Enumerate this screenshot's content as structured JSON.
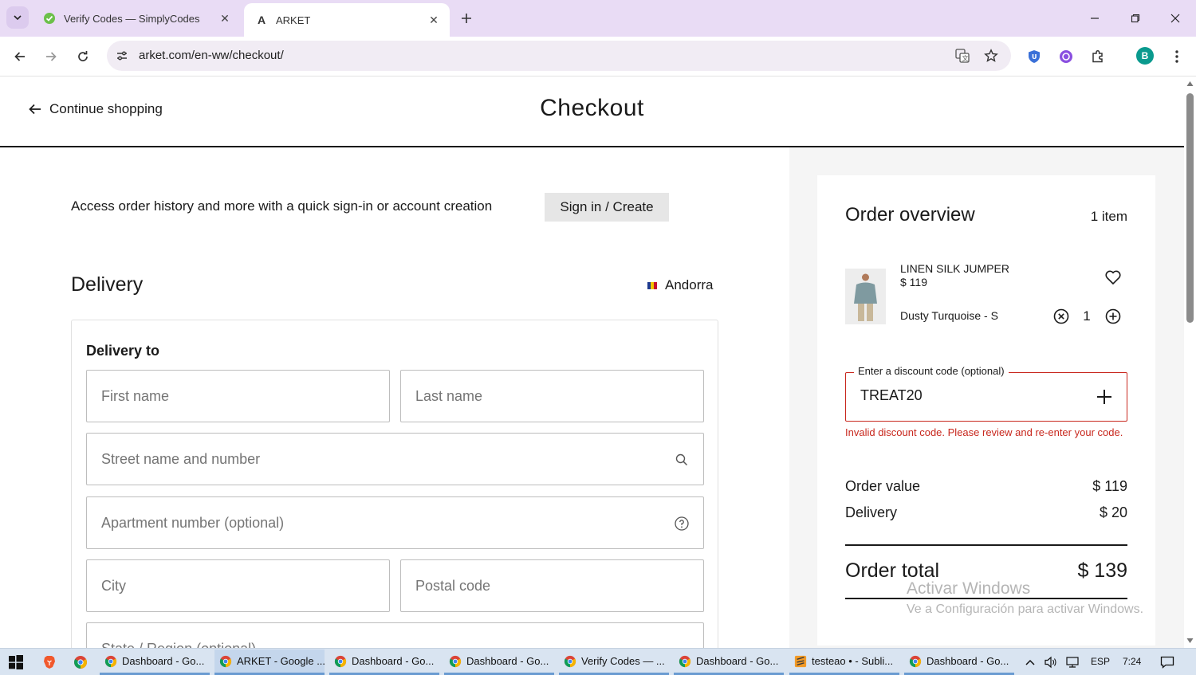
{
  "browser": {
    "tabs": [
      {
        "title": "Verify Codes — SimplyCodes",
        "active": false
      },
      {
        "title": "ARKET",
        "active": true
      }
    ],
    "url": "arket.com/en-ww/checkout/",
    "profile_initial": "B"
  },
  "header": {
    "continue_label": "Continue shopping",
    "title": "Checkout"
  },
  "account": {
    "prompt": "Access order history and more with a quick sign-in or account creation",
    "signin_label": "Sign in / Create"
  },
  "delivery": {
    "heading": "Delivery",
    "country": "Andorra",
    "card_heading": "Delivery to",
    "placeholders": {
      "first_name": "First name",
      "last_name": "Last name",
      "street": "Street name and number",
      "apartment": "Apartment number (optional)",
      "city": "City",
      "postal": "Postal code",
      "state": "State / Region (optional)"
    }
  },
  "order": {
    "heading": "Order overview",
    "item_count": "1 item",
    "product": {
      "name": "LINEN SILK JUMPER",
      "price": "$ 119",
      "variant": "Dusty Turquoise - S",
      "quantity": "1"
    },
    "discount": {
      "label": "Enter a discount code (optional)",
      "value": "TREAT20",
      "error": "Invalid discount code. Please review and re-enter your code."
    },
    "summary": {
      "order_value_label": "Order value",
      "order_value": "$ 119",
      "delivery_label": "Delivery",
      "delivery_value": "$ 20",
      "total_label": "Order total",
      "total_value": "$ 139"
    }
  },
  "watermark": {
    "line1": "Activar Windows",
    "line2": "Ve a Configuración para activar Windows."
  },
  "taskbar": {
    "items": [
      "Dashboard - Go...",
      "ARKET - Google ...",
      "Dashboard - Go...",
      "Dashboard - Go...",
      "Verify Codes — ...",
      "Dashboard - Go...",
      "testeao • - Subli...",
      "Dashboard - Go..."
    ],
    "language": "ESP",
    "time": "7:24"
  },
  "colors": {
    "tabbar": "#e9dcf5",
    "error": "#c8281e",
    "summary_bg": "#f5f5f5",
    "taskbar": "#d9e4f1"
  }
}
